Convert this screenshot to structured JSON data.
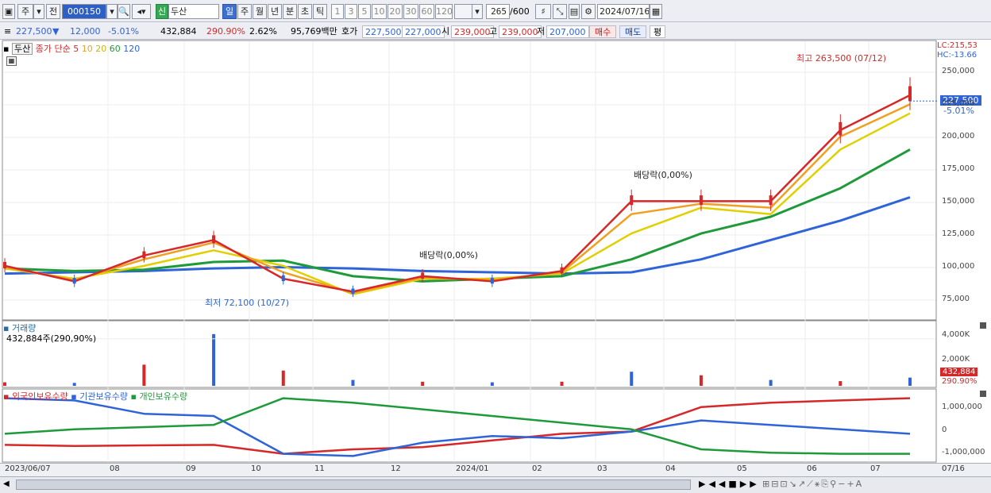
{
  "toolbar": {
    "market_label": "주",
    "prev_label": "전",
    "stock_code": "000150",
    "stock_badge": "신",
    "stock_name": "두산",
    "periods": [
      "일",
      "주",
      "월",
      "년",
      "분",
      "초",
      "틱"
    ],
    "selected_period": "일",
    "minute_options": [
      "1",
      "3",
      "5",
      "10",
      "20",
      "30",
      "60",
      "120"
    ],
    "count_value": "265",
    "count_max": "/600",
    "date": "2024/07/16"
  },
  "quote": {
    "price": "227,500",
    "arrow": "▼",
    "change": "12,000",
    "change_pct": "-5.01%",
    "volume": "432,884",
    "volume_pct": "290.90%",
    "turnover_pct": "2.62%",
    "amount": "95,769백만",
    "bid_label": "호가",
    "ask_price": "227,500",
    "bid_price": "227,000",
    "open_label": "시",
    "open": "239,000",
    "high_label": "고",
    "high": "239,000",
    "low_label": "저",
    "low": "207,000",
    "buy_label": "매수",
    "sell_label": "매도",
    "eval_label": "평"
  },
  "price_panel": {
    "name_tag": "두산",
    "legend_title": "종가 단순",
    "ma": [
      {
        "period": "5",
        "color": "#d62828"
      },
      {
        "period": "10",
        "color": "#f0a020"
      },
      {
        "period": "20",
        "color": "#e0d000"
      },
      {
        "period": "60",
        "color": "#1f9a3a"
      },
      {
        "period": "120",
        "color": "#2f64d8"
      }
    ],
    "lc_label": "LC:215,53",
    "hc_label": "HC:-13.66",
    "high_annot": "최고 263,500 (07/12)",
    "low_annot": "최저 72,100 (10/27)",
    "dividend_1": "배당락(0,00%)",
    "dividend_2": "배당락(0,00%)",
    "last_price_tag": "227,500",
    "last_pct_tag": "-5.01%",
    "y_ticks": [
      "250,000",
      "225,000",
      "200,000",
      "175,000",
      "150,000",
      "125,000",
      "100,000",
      "75,000"
    ]
  },
  "volume_panel": {
    "title": "거래량",
    "info": "432,884주(290,90%)",
    "y_ticks": [
      "4,000K",
      "2,000K"
    ],
    "last_tag": "432,884",
    "last_pct": "290.90%"
  },
  "holding_panel": {
    "legend": [
      {
        "label": "외국인보유수량",
        "color": "#d62828"
      },
      {
        "label": "기관보유수량",
        "color": "#2f64d8"
      },
      {
        "label": "개인보유수량",
        "color": "#1f9a3a"
      }
    ],
    "y_ticks": [
      "1,000,000",
      "0",
      "-1,000,000"
    ]
  },
  "x_axis": {
    "labels": [
      "2023/06/07",
      "08",
      "09",
      "10",
      "11",
      "12",
      "2024/01",
      "02",
      "03",
      "04",
      "05",
      "06",
      "07"
    ],
    "right_label": "07/16"
  },
  "colors": {
    "up": "#d62828",
    "down": "#2f64d8",
    "ma5": "#d62828",
    "ma10": "#f0a020",
    "ma20": "#e0d000",
    "ma60": "#1f9a3a",
    "ma120": "#2f64d8"
  },
  "chart_data": [
    {
      "type": "line",
      "title": "",
      "xlabel": "",
      "ylabel": "",
      "ylim": [
        60000,
        270000
      ],
      "x": [
        "2023/06",
        "2023/07",
        "2023/08",
        "2023/09",
        "2023/10",
        "2023/11",
        "2023/12",
        "2024/01",
        "2024/02",
        "2024/03",
        "2024/04",
        "2024/05",
        "2024/06",
        "2024/07"
      ],
      "series": [
        {
          "name": "5",
          "values": [
            100000,
            88000,
            108000,
            120000,
            90000,
            80000,
            92000,
            88000,
            96000,
            150000,
            150000,
            150000,
            205000,
            232000
          ]
        },
        {
          "name": "10",
          "values": [
            99000,
            89000,
            105000,
            118000,
            95000,
            79000,
            91000,
            89000,
            95000,
            140000,
            148000,
            145000,
            200000,
            225000
          ]
        },
        {
          "name": "20",
          "values": [
            98000,
            90000,
            100000,
            112000,
            100000,
            78000,
            90000,
            90000,
            94000,
            125000,
            145000,
            140000,
            190000,
            218000
          ]
        },
        {
          "name": "60",
          "values": [
            98000,
            96000,
            97000,
            103000,
            104000,
            92000,
            88000,
            90000,
            92000,
            105000,
            125000,
            138000,
            160000,
            190000
          ]
        },
        {
          "name": "120",
          "values": [
            94000,
            95000,
            96000,
            98000,
            99000,
            98000,
            96000,
            95000,
            94000,
            95000,
            105000,
            120000,
            135000,
            153000
          ]
        }
      ]
    },
    {
      "type": "bar",
      "title": "",
      "ylabel": "",
      "ylim": [
        0,
        5000
      ],
      "categories": [
        "2023/06",
        "2023/07",
        "2023/08",
        "2023/09",
        "2023/10",
        "2023/11",
        "2023/12",
        "2024/01",
        "2024/02",
        "2024/03",
        "2024/04",
        "2024/05",
        "2024/06",
        "2024/07"
      ],
      "values": [
        300,
        250,
        1800,
        4400,
        1300,
        500,
        350,
        300,
        350,
        1200,
        900,
        500,
        400,
        700
      ]
    },
    {
      "type": "line",
      "title": "",
      "ylim": [
        -1500000,
        1500000
      ],
      "x": [
        "2023/06",
        "2023/07",
        "2023/08",
        "2023/09",
        "2023/10",
        "2023/11",
        "2023/12",
        "2024/01",
        "2024/02",
        "2024/03",
        "2024/04",
        "2024/05",
        "2024/06",
        "2024/07"
      ],
      "series": [
        {
          "name": "외국인보유수량",
          "values": [
            -800000,
            -850000,
            -820000,
            -800000,
            -1200000,
            -1000000,
            -900000,
            -600000,
            -300000,
            -200000,
            900000,
            1100000,
            1200000,
            1300000
          ]
        },
        {
          "name": "기관보유수량",
          "values": [
            1300000,
            1200000,
            600000,
            500000,
            -1200000,
            -1300000,
            -700000,
            -400000,
            -500000,
            -200000,
            300000,
            100000,
            -100000,
            -300000
          ]
        },
        {
          "name": "개인보유수량",
          "values": [
            -300000,
            -100000,
            0,
            100000,
            1300000,
            1100000,
            800000,
            500000,
            200000,
            -100000,
            -1000000,
            -1150000,
            -1200000,
            -1200000
          ]
        }
      ]
    }
  ]
}
